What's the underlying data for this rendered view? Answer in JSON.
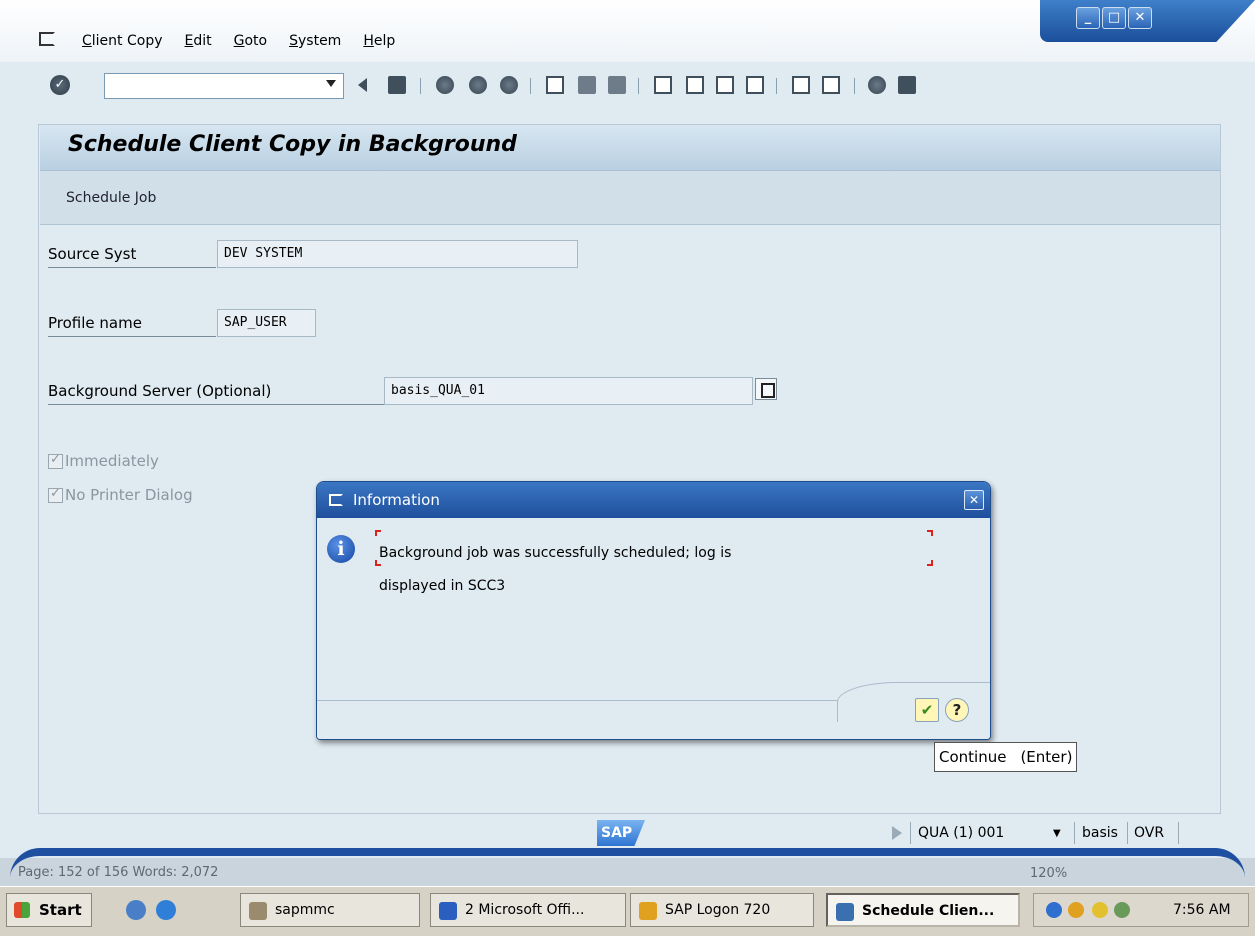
{
  "menubar": {
    "items": [
      "Client Copy",
      "Edit",
      "Goto",
      "System",
      "Help"
    ]
  },
  "window_controls": {
    "minimize": "_",
    "maximize": "□",
    "close": "✕"
  },
  "toolbar": {
    "command_field_value": ""
  },
  "page": {
    "title": "Schedule Client Copy in Background",
    "app_toolbar": {
      "schedule_job_label": "Schedule Job"
    }
  },
  "form": {
    "source_system": {
      "label": "Source Syst",
      "value": "DEV SYSTEM"
    },
    "profile_name": {
      "label": "Profile name",
      "value": "SAP_USER"
    },
    "background_server": {
      "label": "Background Server (Optional)",
      "value": "basis_QUA_01"
    },
    "checkboxes": [
      {
        "label": "Immediately",
        "checked": true,
        "enabled": false
      },
      {
        "label": "No Printer Dialog",
        "checked": true,
        "enabled": false
      }
    ]
  },
  "dialog": {
    "title": "Information",
    "message_line1": "Background job was successfully scheduled; log is",
    "message_line2": "displayed in SCC3",
    "buttons": {
      "continue_icon": "✔",
      "help_icon": "?"
    },
    "tooltip": {
      "label": "Continue",
      "shortcut": "(Enter)"
    }
  },
  "statusbar": {
    "logo": "SAP",
    "system": "QUA (1) 001",
    "user": "basis",
    "mode": "OVR"
  },
  "background_word": {
    "left_text": "Page: 152 of 156    Words: 2,072",
    "zoom": "120%"
  },
  "taskbar": {
    "start_label": "Start",
    "items": [
      {
        "label": "sapmmc",
        "active": false
      },
      {
        "label": "2 Microsoft Offi...",
        "active": false
      },
      {
        "label": "SAP Logon 720",
        "active": false
      },
      {
        "label": "Schedule Clien...",
        "active": true
      }
    ],
    "clock": "7:56 AM"
  },
  "colors": {
    "window_blue": "#1f4f9c",
    "background": "#dfeaf1",
    "title_bar": "#b9d0e2",
    "checkmark_green": "#3a8a1c"
  }
}
